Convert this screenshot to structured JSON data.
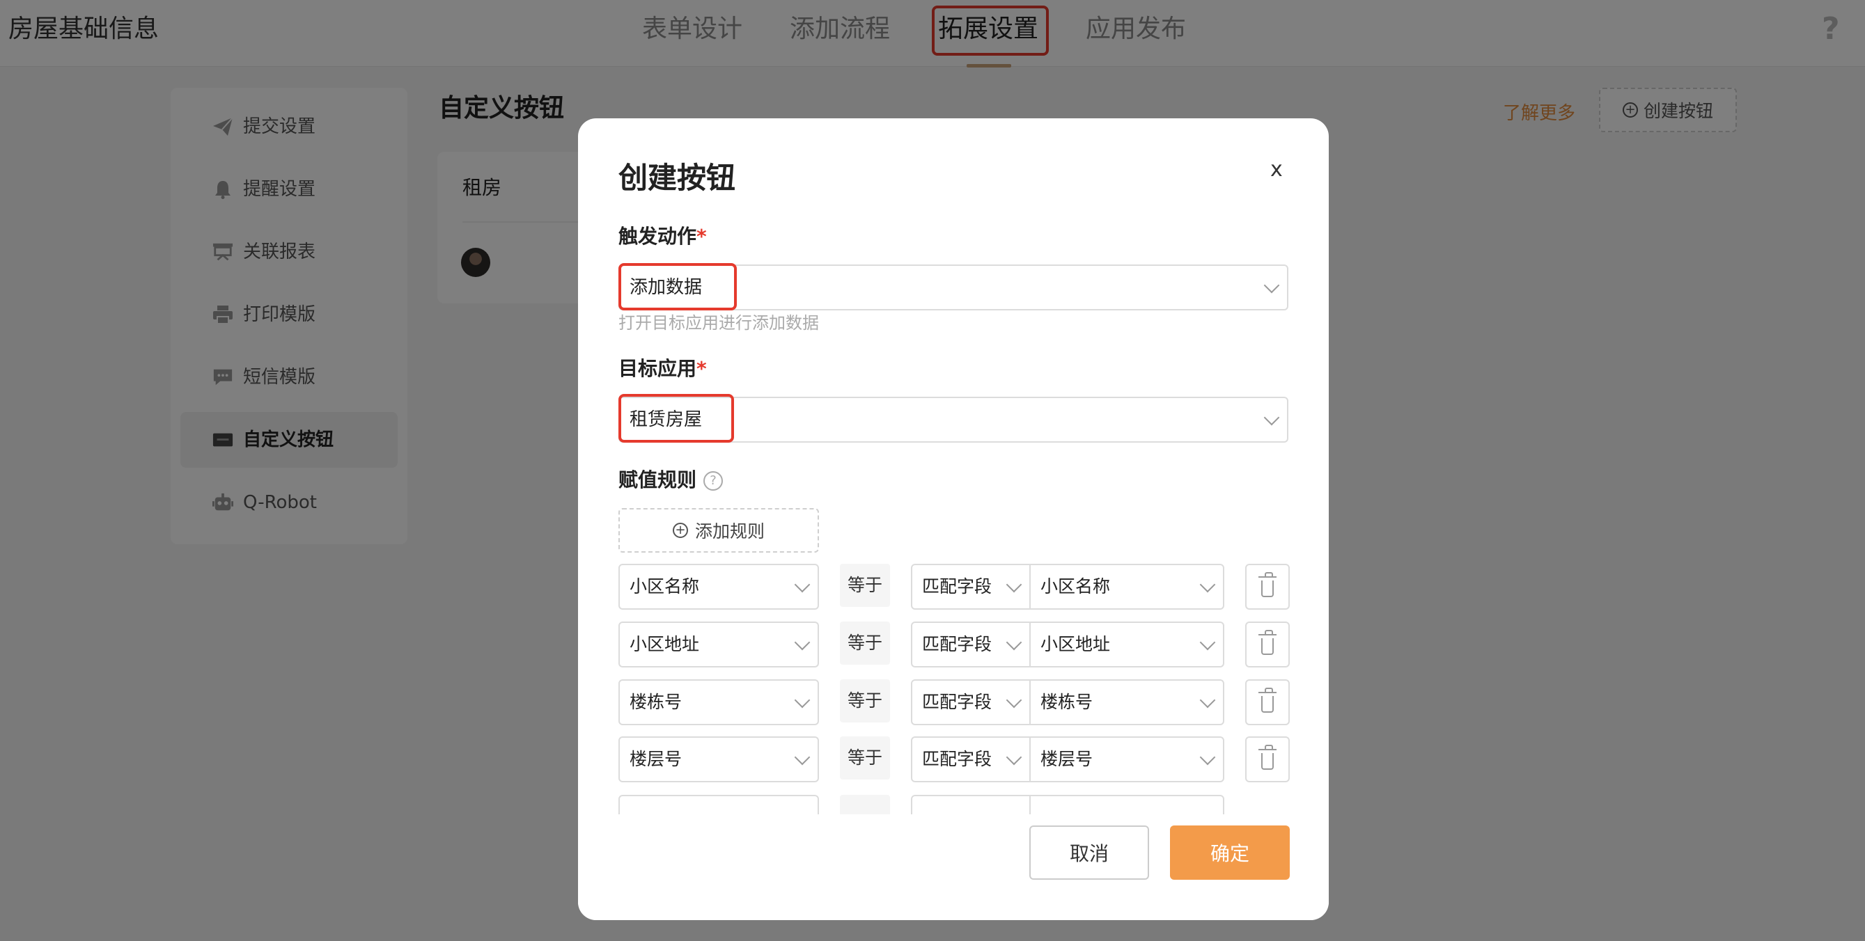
{
  "header": {
    "app_title": "房屋基础信息",
    "tabs": [
      {
        "label": "表单设计"
      },
      {
        "label": "添加流程"
      },
      {
        "label": "拓展设置",
        "active": true
      },
      {
        "label": "应用发布"
      }
    ],
    "help": "?"
  },
  "side_menu": {
    "items": [
      {
        "label": "提交设置",
        "icon": "send-icon"
      },
      {
        "label": "提醒设置",
        "icon": "bell-icon"
      },
      {
        "label": "关联报表",
        "icon": "report-icon"
      },
      {
        "label": "打印模版",
        "icon": "printer-icon"
      },
      {
        "label": "短信模版",
        "icon": "message-icon"
      },
      {
        "label": "自定义按钮",
        "icon": "button-icon",
        "active": true
      },
      {
        "label": "Q-Robot",
        "icon": "robot-icon"
      }
    ]
  },
  "main": {
    "heading": "自定义按钮",
    "learn_more": "了解更多",
    "create_button": "创建按钮",
    "card_title": "租房"
  },
  "modal": {
    "title": "创建按钮",
    "close": "x",
    "trigger": {
      "label": "触发动作",
      "required": "*",
      "value": "添加数据",
      "hint": "打开目标应用进行添加数据"
    },
    "target_app": {
      "label": "目标应用",
      "required": "*",
      "value": "租赁房屋"
    },
    "rules": {
      "label": "赋值规则",
      "help": "?",
      "add_rule": "添加规则",
      "rows": [
        {
          "field": "小区名称",
          "op": "等于",
          "mode": "匹配字段",
          "target": "小区名称"
        },
        {
          "field": "小区地址",
          "op": "等于",
          "mode": "匹配字段",
          "target": "小区地址"
        },
        {
          "field": "楼栋号",
          "op": "等于",
          "mode": "匹配字段",
          "target": "楼栋号"
        },
        {
          "field": "楼层号",
          "op": "等于",
          "mode": "匹配字段",
          "target": "楼层号"
        }
      ]
    },
    "cancel": "取消",
    "confirm": "确定"
  },
  "colors": {
    "accent": "#f39b4a",
    "highlight": "#e53a2d",
    "link": "#e08a3c"
  }
}
